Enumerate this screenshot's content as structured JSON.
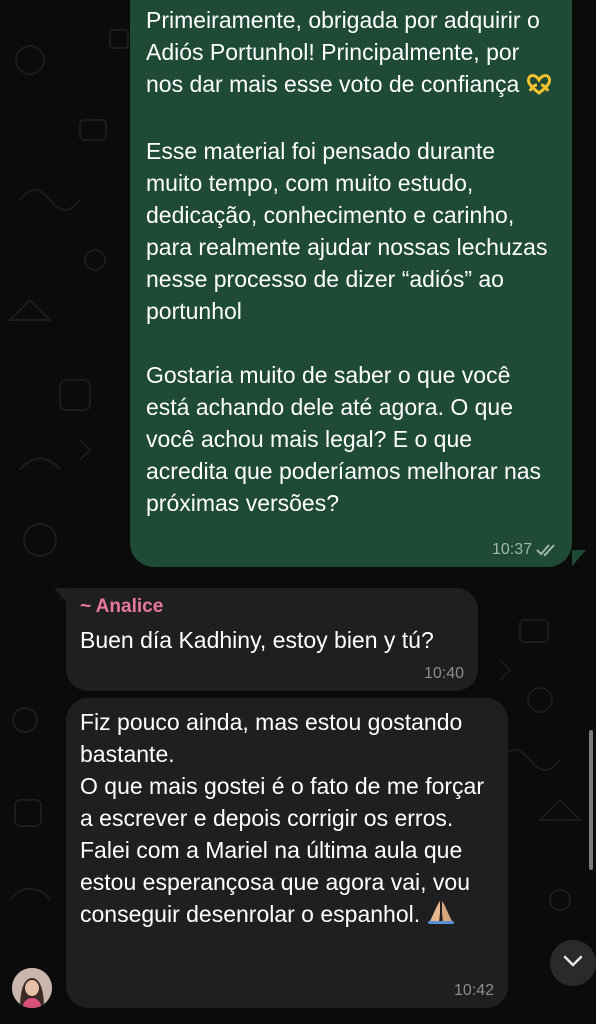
{
  "outgoing": {
    "paragraphs": [
      "Primeiramente, obrigada por adquirir o Adiós Portunhol! Principalmente, por nos dar mais esse voto de confiança",
      "Esse material foi pensado durante muito tempo, com muito estudo, dedicação, conhecimento e carinho, para realmente ajudar nossas lechuzas nesse processo de dizer “adiós” ao portunhol",
      "Gostaria muito de saber o que você está achando dele até agora. O que você achou mais legal? E o que acredita que poderíamos melhorar nas próximas versões?"
    ],
    "time": "10:37",
    "status_icon": "double-check-icon"
  },
  "incoming": [
    {
      "sender": "~ Analice",
      "text": "Buen día Kadhiny, estoy bien y tú?",
      "time": "10:40"
    },
    {
      "lines": [
        "Fiz pouco ainda, mas estou gostando bastante.",
        "O que mais gostei é o fato de me forçar a escrever e depois corrigir os erros.",
        "Falei com a Mariel na última aula que estou esperançosa que agora vai, vou conseguir desenrolar o espanhol."
      ],
      "time": "10:42"
    }
  ],
  "colors": {
    "outgoing_bubble": "#1e4a36",
    "incoming_bubble": "#1f1f1f",
    "sender_name": "#e8799c",
    "background": "#0b0b0b"
  },
  "icons": [
    "heart-hands-emoji",
    "praying-hands-emoji",
    "chevron-down-icon",
    "avatar"
  ]
}
